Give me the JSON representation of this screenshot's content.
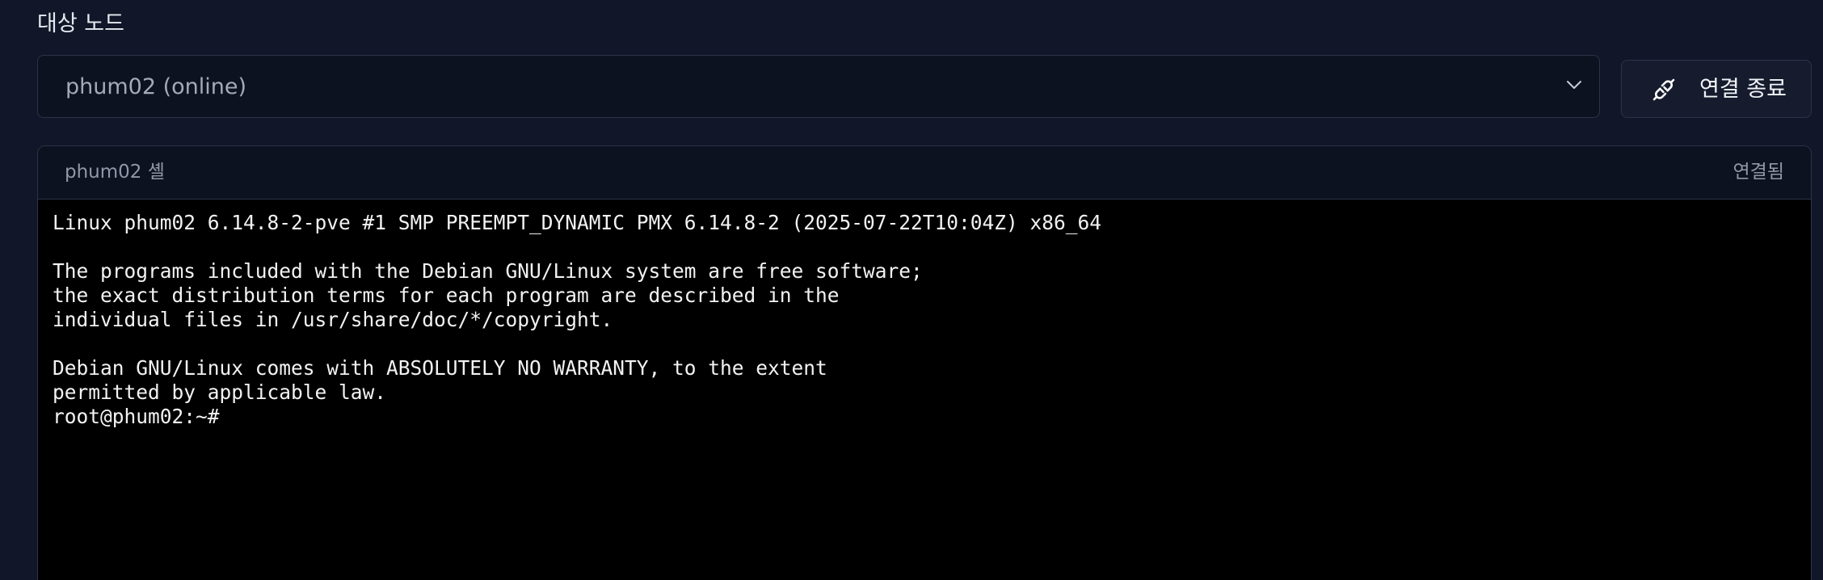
{
  "target_node": {
    "label": "대상 노드",
    "selected_value": "phum02 (online)"
  },
  "disconnect_button": {
    "label": "연결 종료",
    "icon": "link-broken-icon"
  },
  "shell": {
    "title": "phum02 셸",
    "status": "연결됨",
    "lines": [
      "Linux phum02 6.14.8-2-pve #1 SMP PREEMPT_DYNAMIC PMX 6.14.8-2 (2025-07-22T10:04Z) x86_64",
      "",
      "The programs included with the Debian GNU/Linux system are free software;",
      "the exact distribution terms for each program are described in the",
      "individual files in /usr/share/doc/*/copyright.",
      "",
      "Debian GNU/Linux comes with ABSOLUTELY NO WARRANTY, to the extent",
      "permitted by applicable law.",
      "root@phum02:~#"
    ]
  },
  "colors": {
    "page_background": "#111728",
    "panel_background": "#0d1221",
    "border": "#2c3347",
    "terminal_background": "#000000",
    "terminal_text": "#f2f2f2"
  }
}
